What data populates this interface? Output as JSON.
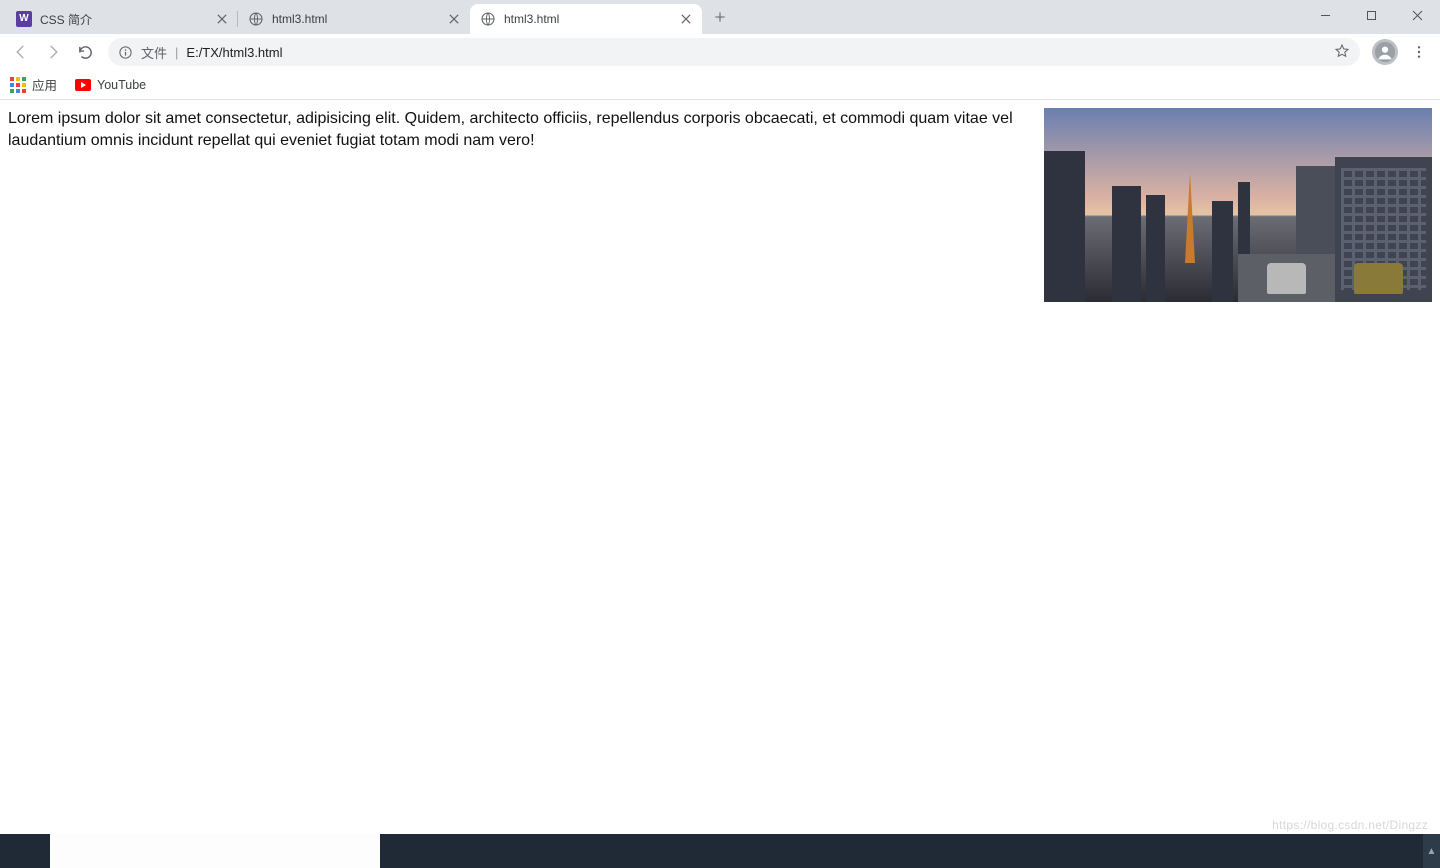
{
  "tabs": [
    {
      "title": "CSS 简介",
      "favicon": "w",
      "active": false
    },
    {
      "title": "html3.html",
      "favicon": "globe",
      "active": false
    },
    {
      "title": "html3.html",
      "favicon": "globe",
      "active": true
    }
  ],
  "window_controls": {
    "minimize": "minimize",
    "maximize": "maximize",
    "close": "close"
  },
  "toolbar": {
    "back_enabled": false,
    "forward_enabled": false,
    "info_label": "ⓘ",
    "file_prefix": "文件",
    "separator": "|",
    "url": "E:/TX/html3.html"
  },
  "bookmarks": [
    {
      "icon": "apps",
      "label": "应用"
    },
    {
      "icon": "youtube",
      "label": "YouTube"
    }
  ],
  "page": {
    "paragraph": "Lorem ipsum dolor sit amet consectetur, adipisicing elit. Quidem, architecto officiis, repellendus corporis obcaecati, et commodi quam vitae vel laudantium omnis incidunt repellat qui eveniet fugiat totam modi nam vero!",
    "image_alt": "city skyline at dusk"
  },
  "watermark": "https://blog.csdn.net/Dingzz"
}
